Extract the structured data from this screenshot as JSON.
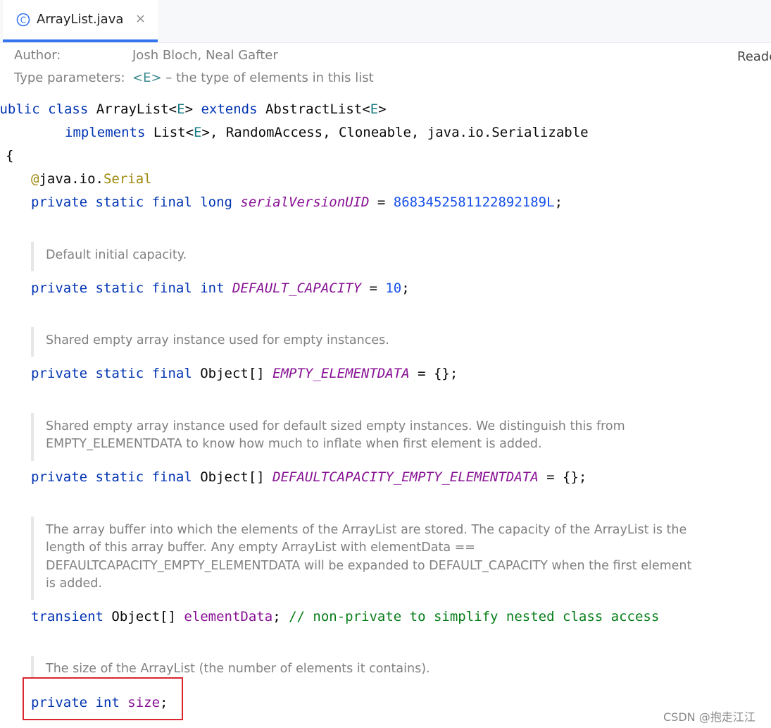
{
  "tab": {
    "filename": "ArrayList.java",
    "close_glyph": "×",
    "icon": "class-icon",
    "icon_letter": "C"
  },
  "reader_mode_label": "Reade",
  "meta": {
    "author_label": "Author:",
    "author_value": "Josh Bloch, Neal Gafter",
    "type_params_label": "Type parameters:",
    "type_param_name": "<E>",
    "type_param_desc": " – the type of elements in this list"
  },
  "code": {
    "class_kw1": "public class ",
    "class_name": "ArrayList<",
    "class_tp": "E",
    "class_close": "> ",
    "extends_kw": "extends ",
    "super_name": "AbstractList<",
    "super_tp": "E",
    "super_close": ">",
    "implements_kw": "implements ",
    "impl_list": "List<",
    "impl_tp": "E",
    "impl_rest": ">, RandomAccess, Cloneable, java.io.Serializable",
    "open_brace": "{",
    "annotation_at": "@",
    "annotation_pkg": "java.io.",
    "annotation_name": "Serial",
    "serial_kw": "private static final long ",
    "serial_field": "serialVersionUID",
    "serial_eq": " = ",
    "serial_value": "8683452581122892189L",
    "serial_semi": ";",
    "cap_kw": "private static final int ",
    "cap_field": "DEFAULT_CAPACITY",
    "cap_eq": " = ",
    "cap_value": "10",
    "cap_semi": ";",
    "empty_kw": "private static final ",
    "empty_type": "Object[] ",
    "empty_field": "EMPTY_ELEMENTDATA",
    "empty_rest": " = {};",
    "dflt_kw": "private static final ",
    "dflt_type": "Object[] ",
    "dflt_field": "DEFAULTCAPACITY_EMPTY_ELEMENTDATA",
    "dflt_rest": " = {};",
    "elem_kw": "transient ",
    "elem_type": "Object[] ",
    "elem_field": "elementData",
    "elem_semi": "; ",
    "elem_comment": "// non-private to simplify nested class access",
    "size_kw1": "private ",
    "size_kw2": "int ",
    "size_field": "size",
    "size_semi": ";"
  },
  "docs": {
    "capacity": "Default initial capacity.",
    "empty_elementdata": "Shared empty array instance used for empty instances.",
    "default_empty_elementdata": "Shared empty array instance used for default sized empty instances. We distinguish this from EMPTY_ELEMENTDATA to know how much to inflate when first element is added.",
    "element_data": "The array buffer into which the elements of the ArrayList are stored. The capacity of the ArrayList is the length of this array buffer. Any empty ArrayList with elementData == DEFAULTCAPACITY_EMPTY_ELEMENTDATA will be expanded to DEFAULT_CAPACITY when the first element is added.",
    "size": "The size of the ArrayList (the number of elements it contains)."
  },
  "watermark": "CSDN @抱走江江",
  "colors": {
    "keyword": "#0033b3",
    "type_param": "#167b83",
    "field": "#871094",
    "number": "#1750eb",
    "annotation": "#9e880d",
    "comment": "#067d17",
    "doc_text": "#808080",
    "highlight": "#d9262f",
    "tab_accent": "#3574f0"
  }
}
